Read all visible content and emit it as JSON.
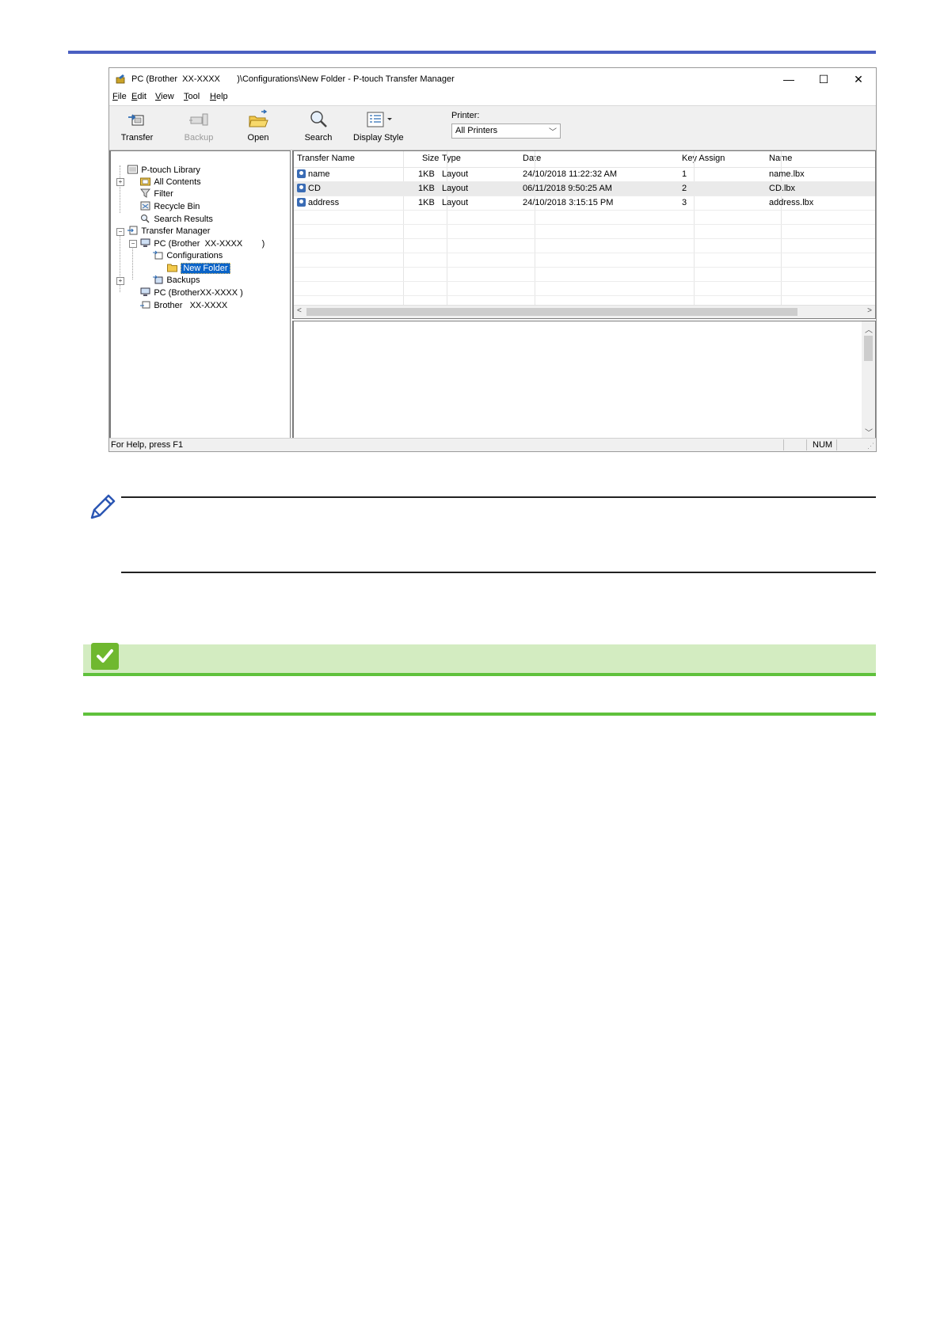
{
  "window": {
    "title": "PC (Brother  XX-XXXX       )\\Configurations\\New Folder - P-touch Transfer Manager",
    "controls": {
      "minimize": "—",
      "maximize": "☐",
      "close": "✕"
    }
  },
  "menu": {
    "items": [
      {
        "mnemonic": "F",
        "rest": "ile"
      },
      {
        "mnemonic": "E",
        "rest": "dit"
      },
      {
        "mnemonic": "V",
        "rest": "iew"
      },
      {
        "mnemonic": "T",
        "rest": "ool"
      },
      {
        "mnemonic": "H",
        "rest": "elp"
      }
    ]
  },
  "toolbar": {
    "transfer": "Transfer",
    "backup": "Backup",
    "open": "Open",
    "search": "Search",
    "display_style": "Display Style",
    "printer_label": "Printer:",
    "printer_value": "All Printers"
  },
  "tree": {
    "items": [
      "P-touch Library",
      "All Contents",
      "Filter",
      "Recycle Bin",
      "Search Results",
      "Transfer Manager",
      "PC (Brother  XX-XXXX        )",
      "Configurations",
      "New Folder",
      "Backups",
      "PC (BrotherXX-XXXX )",
      "Brother   XX-XXXX"
    ]
  },
  "list": {
    "columns": [
      "Transfer Name",
      "Size",
      "Type",
      "Date",
      "Key Assign",
      "Name"
    ],
    "rows": [
      {
        "name": "name",
        "size": "1KB",
        "type": "Layout",
        "date": "24/10/2018 11:22:32 AM",
        "key": "1",
        "file": "name.lbx"
      },
      {
        "name": "CD",
        "size": "1KB",
        "type": "Layout",
        "date": "06/11/2018 9:50:25 AM",
        "key": "2",
        "file": "CD.lbx"
      },
      {
        "name": "address",
        "size": "1KB",
        "type": "Layout",
        "date": "24/10/2018 3:15:15 PM",
        "key": "3",
        "file": "address.lbx"
      }
    ]
  },
  "status": {
    "help": "For Help, press F1",
    "num": "NUM"
  },
  "colors": {
    "top_rule": "#4a5fc1",
    "selection": "#0a64c8",
    "green_bar": "#d3ecc1",
    "green_line": "#5fc13c"
  }
}
